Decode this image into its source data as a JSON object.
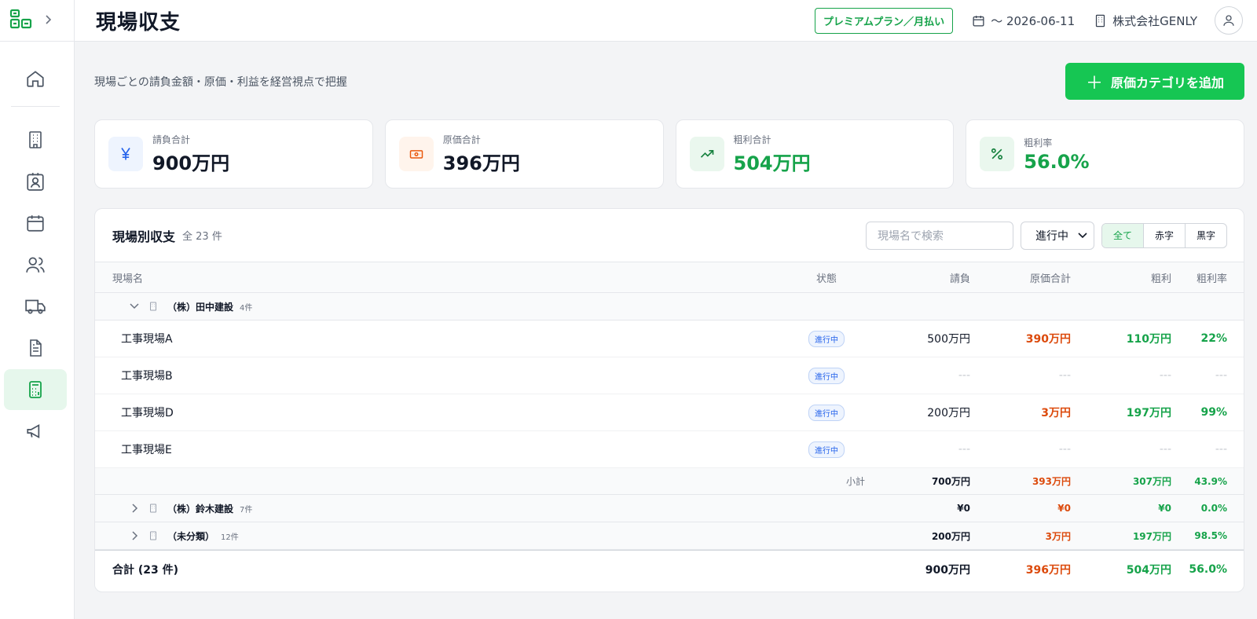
{
  "header": {
    "title": "現場収支",
    "plan": "プレミアムプラン／月払い",
    "date": "〜 2026-06-11",
    "company": "株式会社GENLY"
  },
  "main": {
    "subtitle": "現場ごとの請負金額・原価・利益を経営視点で把握",
    "add_button": "原価カテゴリを追加"
  },
  "cards": [
    {
      "label": "請負合計",
      "value": "900万円",
      "icon": "yen-icon"
    },
    {
      "label": "原価合計",
      "value": "396万円",
      "icon": "cash-icon"
    },
    {
      "label": "粗利合計",
      "value": "504万円",
      "icon": "trend-up-icon"
    },
    {
      "label": "粗利率",
      "value": "56.0%",
      "icon": "percent-icon"
    }
  ],
  "panel": {
    "title": "現場別収支",
    "count": "全 23 件",
    "search_placeholder": "現場名で検索",
    "status_select": "進行中",
    "filters": [
      "全て",
      "赤字",
      "黒字"
    ]
  },
  "table": {
    "columns": [
      "現場名",
      "状態",
      "請負",
      "原価合計",
      "粗利",
      "粗利率"
    ],
    "group1": {
      "name": "（株）田中建設",
      "count": "4件",
      "rows": [
        {
          "name": "工事現場A",
          "status": "進行中",
          "contract": "500万円",
          "cost": "390万円",
          "profit": "110万円",
          "rate": "22%"
        },
        {
          "name": "工事現場B",
          "status": "進行中",
          "contract": "---",
          "cost": "---",
          "profit": "---",
          "rate": "---"
        },
        {
          "name": "工事現場D",
          "status": "進行中",
          "contract": "200万円",
          "cost": "3万円",
          "profit": "197万円",
          "rate": "99%"
        },
        {
          "name": "工事現場E",
          "status": "進行中",
          "contract": "---",
          "cost": "---",
          "profit": "---",
          "rate": "---"
        }
      ],
      "subtotal": {
        "label": "小計",
        "contract": "700万円",
        "cost": "393万円",
        "profit": "307万円",
        "rate": "43.9%"
      }
    },
    "group2": {
      "name": "（株）鈴木建設",
      "count": "7件",
      "contract": "¥0",
      "cost": "¥0",
      "profit": "¥0",
      "rate": "0.0%"
    },
    "group3": {
      "name": "（未分類）",
      "count": "12件",
      "contract": "200万円",
      "cost": "3万円",
      "profit": "197万円",
      "rate": "98.5%"
    },
    "total": {
      "label": "合計 (23 件)",
      "contract": "900万円",
      "cost": "396万円",
      "profit": "504万円",
      "rate": "56.0%"
    }
  },
  "colors": {
    "accent": "#16c653",
    "red": "#dc4a0c",
    "green": "#16a34a"
  }
}
